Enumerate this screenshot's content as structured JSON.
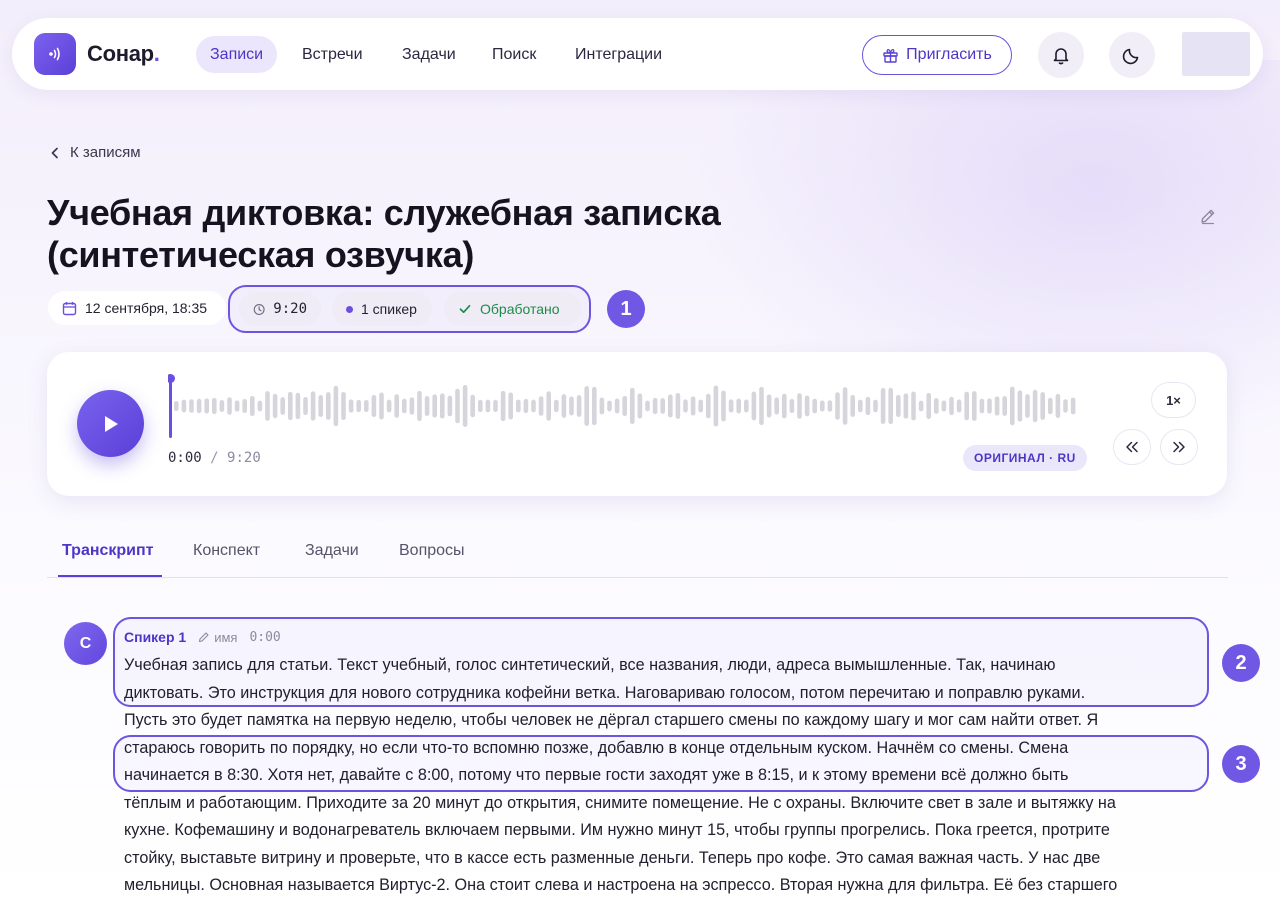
{
  "nav": {
    "brand": "Сонар",
    "brand_dot": ".",
    "items": [
      {
        "label": "Записи",
        "active": true
      },
      {
        "label": "Встречи",
        "active": false
      },
      {
        "label": "Задачи",
        "active": false
      },
      {
        "label": "Поиск",
        "active": false
      },
      {
        "label": "Интеграции",
        "active": false
      }
    ],
    "invite_label": "Пригласить",
    "icons": [
      "gift-icon",
      "bell-icon",
      "moon-icon"
    ]
  },
  "back_label": "К записям",
  "recording": {
    "title": "Учебная диктовка: служебная записка (синтетическая озвучка)",
    "date": "12 сентября, 18:35",
    "duration": "9:20",
    "speakers": "1 спикер",
    "status": "Обработано",
    "status_color": "#1f8a4c"
  },
  "annotations": [
    "1",
    "2",
    "3"
  ],
  "player": {
    "current": "0:00",
    "separator": "/",
    "total": "9:20",
    "language_tag": "ОРИГИНАЛ · RU",
    "speed": "1×",
    "progress": 0
  },
  "tabs": [
    {
      "label": "Транскрипт",
      "active": true
    },
    {
      "label": "Конспект",
      "active": false
    },
    {
      "label": "Задачи",
      "active": false
    },
    {
      "label": "Вопросы",
      "active": false
    }
  ],
  "transcript": {
    "speaker_initial": "С",
    "speaker_name": "Спикер 1",
    "rename_label": "имя",
    "timestamp": "0:00",
    "lines": [
      "Учебная запись для статьи. Текст учебный, голос синтетический, все названия, люди, адреса вымышленные. Так, начинаю",
      "диктовать. Это инструкция для нового сотрудника кофейни ветка. Наговариваю голосом, потом перечитаю и поправлю руками.",
      "Пусть это будет памятка на первую неделю, чтобы человек не дёргал старшего смены по каждому шагу и мог сам найти ответ. Я",
      "стараюсь говорить по порядку, но если что-то вспомню позже, добавлю в конце отдельным куском. Начнём со смены. Смена",
      "начинается в 8:30. Хотя нет, давайте с 8:00, потому что первые гости заходят уже в 8:15, и к этому времени всё должно быть",
      "тёплым и работающим. Приходите за 20 минут до открытия, снимите помещение. Не с охраны. Включите свет в зале и вытяжку на",
      "кухне. Кофемашину и водонагреватель включаем первыми. Им нужно минут 15, чтобы группы прогрелись. Пока греется, протрите",
      "стойку, выставьте витрину и проверьте, что в кассе есть разменные деньги. Теперь про кофе. Это самая важная часть. У нас две",
      "мельницы. Основная называется Виртус-2. Она стоит слева и настроена на эспрессо. Вторая нужна для фильтра. Её без старшего"
    ]
  }
}
